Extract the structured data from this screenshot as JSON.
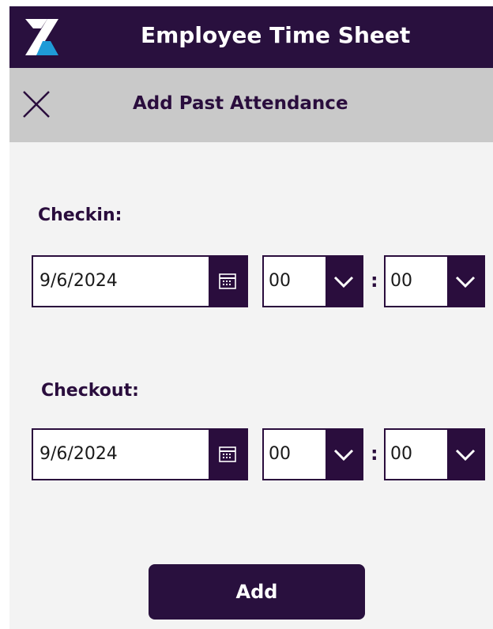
{
  "header": {
    "title": "Employee Time Sheet",
    "logo_icon": "brand-x-logo"
  },
  "subheader": {
    "title": "Add Past Attendance",
    "close_icon": "close-icon"
  },
  "checkin": {
    "label": "Checkin:",
    "date": "9/6/2024",
    "hour": "00",
    "minute": "00",
    "separator": ":"
  },
  "checkout": {
    "label": "Checkout:",
    "date": "9/6/2024",
    "hour": "00",
    "minute": "00",
    "separator": ":"
  },
  "actions": {
    "add_label": "Add"
  },
  "colors": {
    "primary": "#29103e",
    "logo_light": "#ffffff",
    "logo_blue": "#1f9bd7",
    "background": "#f3f3f3",
    "subheader_bg": "#c9c9c9"
  }
}
